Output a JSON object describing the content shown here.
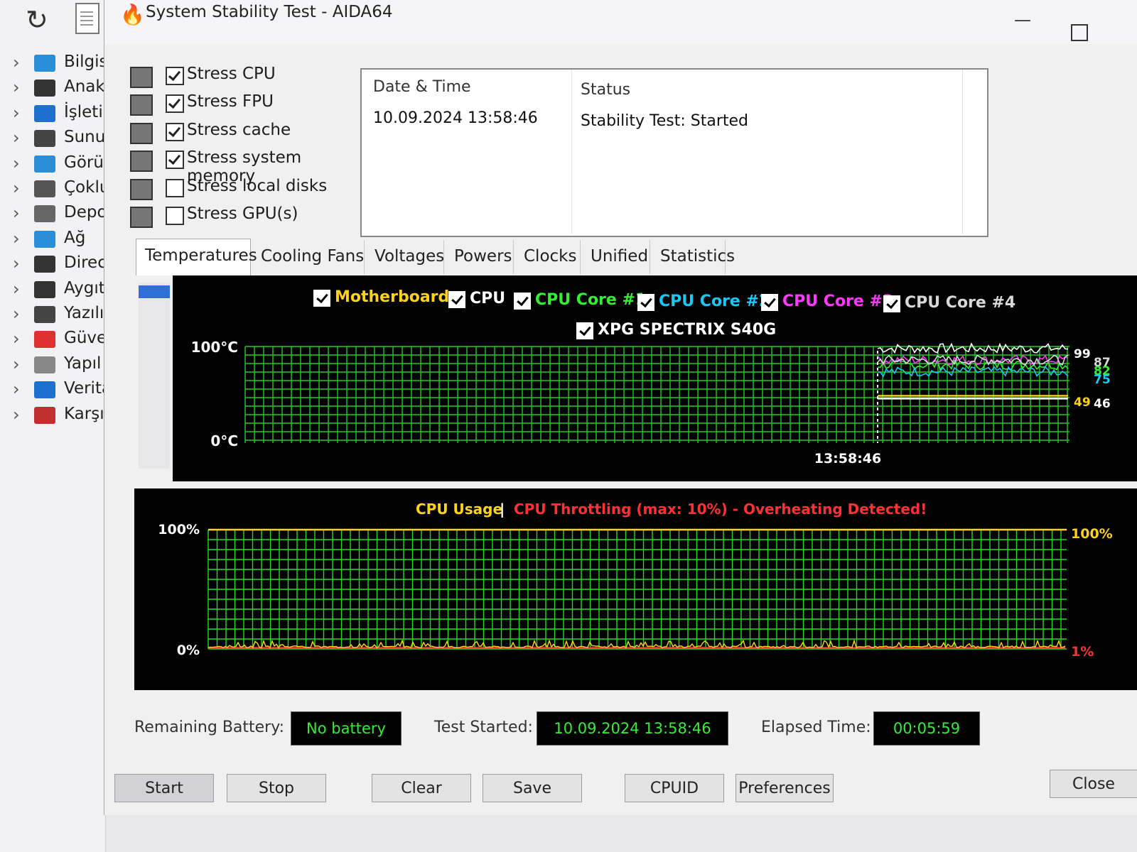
{
  "sidebar": {
    "items": [
      {
        "label": "Bilgis",
        "icon": "computer-icon"
      },
      {
        "label": "Anak",
        "icon": "motherboard-icon"
      },
      {
        "label": "İşletir",
        "icon": "windows-icon"
      },
      {
        "label": "Sunu",
        "icon": "server-icon"
      },
      {
        "label": "Görü",
        "icon": "display-icon"
      },
      {
        "label": "Çoklu",
        "icon": "multimedia-icon"
      },
      {
        "label": "Depo",
        "icon": "storage-icon"
      },
      {
        "label": "Ağ",
        "icon": "network-icon"
      },
      {
        "label": "Direc",
        "icon": "directx-icon"
      },
      {
        "label": "Aygıt",
        "icon": "devices-icon"
      },
      {
        "label": "Yazılı",
        "icon": "software-icon"
      },
      {
        "label": "Güve",
        "icon": "security-icon"
      },
      {
        "label": "Yapıl",
        "icon": "config-icon"
      },
      {
        "label": "Verita",
        "icon": "database-icon"
      },
      {
        "label": "Karşıl",
        "icon": "benchmark-icon"
      }
    ]
  },
  "window": {
    "title": "System Stability Test - AIDA64",
    "min_glyph": "—"
  },
  "stress_options": [
    {
      "label": "Stress CPU",
      "checked": true,
      "icon": "cpu-icon"
    },
    {
      "label": "Stress FPU",
      "checked": true,
      "icon": "fpu-icon"
    },
    {
      "label": "Stress cache",
      "checked": true,
      "icon": "cache-icon"
    },
    {
      "label": "Stress system memory",
      "checked": true,
      "icon": "memory-icon"
    },
    {
      "label": "Stress local disks",
      "checked": false,
      "icon": "disk-icon"
    },
    {
      "label": "Stress GPU(s)",
      "checked": false,
      "icon": "gpu-icon"
    }
  ],
  "log": {
    "col_datetime": "Date & Time",
    "col_status": "Status",
    "rows": [
      {
        "datetime": "10.09.2024 13:58:46",
        "status": "Stability Test: Started"
      }
    ]
  },
  "tabs": [
    "Temperatures",
    "Cooling Fans",
    "Voltages",
    "Powers",
    "Clocks",
    "Unified",
    "Statistics"
  ],
  "active_tab": "Temperatures",
  "temperature_chart": {
    "legend": [
      {
        "label": "Motherboard",
        "color": "#ffd21a"
      },
      {
        "label": "CPU",
        "color": "#ffffff"
      },
      {
        "label": "CPU Core #1",
        "color": "#33ee33"
      },
      {
        "label": "CPU Core #2",
        "color": "#19c8f5"
      },
      {
        "label": "CPU Core #3",
        "color": "#ff38ff"
      },
      {
        "label": "CPU Core #4",
        "color": "#d8d8d8"
      },
      {
        "label": "XPG SPECTRIX S40G",
        "color": "#ffffff"
      }
    ],
    "y_max_label": "100°C",
    "y_min_label": "0°C",
    "time_label": "13:58:46",
    "right_labels": [
      {
        "text": "99",
        "color": "#ffffff"
      },
      {
        "text": "87",
        "color": "#d8d8d8"
      },
      {
        "text": "82",
        "color": "#33ee33"
      },
      {
        "text": "75",
        "color": "#19c8f5"
      },
      {
        "text": "49",
        "color": "#ffd21a"
      },
      {
        "text": "46",
        "color": "#ffffff"
      }
    ]
  },
  "usage_chart": {
    "title_usage": "CPU Usage",
    "title_sep": "|",
    "title_throttle": "CPU Throttling (max: 10%) - Overheating Detected!",
    "y_max_label": "100%",
    "y_min_label": "0%",
    "right_top_label": "100%",
    "right_bottom_label": "1%",
    "colors": {
      "usage": "#ffd21a",
      "throttle": "#ff3030",
      "grid": "#22dd22"
    }
  },
  "chart_data": [
    {
      "type": "line",
      "title": "",
      "ylabel": "°C",
      "ylim": [
        0,
        100
      ],
      "time_marker": "13:58:46",
      "series": [
        {
          "name": "Motherboard",
          "last_value": 49
        },
        {
          "name": "CPU",
          "last_value": 99
        },
        {
          "name": "CPU Core #1",
          "last_value": 82
        },
        {
          "name": "CPU Core #2",
          "last_value": 75
        },
        {
          "name": "CPU Core #3",
          "last_value": 87
        },
        {
          "name": "CPU Core #4",
          "last_value": 87
        },
        {
          "name": "XPG SPECTRIX S40G",
          "last_value": 46
        }
      ]
    },
    {
      "type": "line",
      "title": "CPU Usage | CPU Throttling (max: 10%) - Overheating Detected!",
      "ylim": [
        0,
        100
      ],
      "series": [
        {
          "name": "CPU Usage",
          "last_value": 100
        },
        {
          "name": "CPU Throttling",
          "last_value": 1
        }
      ]
    }
  ],
  "footer_info": {
    "battery_label": "Remaining Battery:",
    "battery_value": "No battery",
    "started_label": "Test Started:",
    "started_value": "10.09.2024 13:58:46",
    "elapsed_label": "Elapsed Time:",
    "elapsed_value": "00:05:59"
  },
  "buttons": {
    "start": "Start",
    "stop": "Stop",
    "clear": "Clear",
    "save": "Save",
    "cpuid": "CPUID",
    "preferences": "Preferences",
    "close": "Close"
  }
}
